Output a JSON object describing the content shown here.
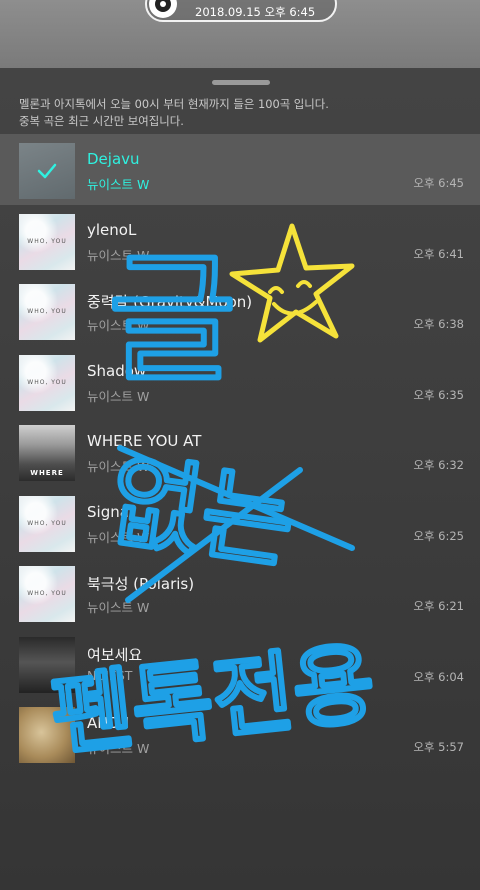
{
  "status": {
    "time": "2018.09.15 오후 6:45",
    "music_icon": "music-disc-icon"
  },
  "notice": {
    "line1": "멜론과 아지톡에서 오늘 00시 부터 현재까지 들은 100곡 입니다.",
    "line2": "중복 곡은 최근 시간만 보여집니다."
  },
  "songs": [
    {
      "title": "Dejavu",
      "artist": "뉴이스트 W",
      "time": "오후 6:45",
      "current": true
    },
    {
      "title": "ylenoL",
      "artist": "뉴이스트 W",
      "time": "오후 6:41",
      "art_text": "WHO, YOU"
    },
    {
      "title": "중력달 (Gravity&Moon)",
      "artist": "뉴이스트 W",
      "time": "오후 6:38",
      "art_text": "WHO, YOU"
    },
    {
      "title": "Shadow",
      "artist": "뉴이스트 W",
      "time": "오후 6:35",
      "art_text": "WHO, YOU"
    },
    {
      "title": "WHERE YOU AT",
      "artist": "뉴이스트 W",
      "time": "오후 6:32",
      "art_text": "WHERE"
    },
    {
      "title": "Signal",
      "artist": "뉴이스트 W",
      "time": "오후 6:25",
      "art_text": "WHO, YOU"
    },
    {
      "title": "북극성 (Polaris)",
      "artist": "뉴이스트 W",
      "time": "오후 6:21",
      "art_text": "WHO, YOU"
    },
    {
      "title": "여보세요",
      "artist": "NU'EST",
      "time": "오후 6:04"
    },
    {
      "title": "AND I",
      "artist": "뉴이스트 W",
      "time": "오후 5:57"
    }
  ],
  "handwriting": {
    "word1": "글",
    "word2": "없는",
    "word3": "펜톡전용"
  },
  "colors": {
    "accent": "#2ff1e0",
    "pen_blue": "#1ea0e6",
    "pen_yellow": "#f5e23a"
  }
}
